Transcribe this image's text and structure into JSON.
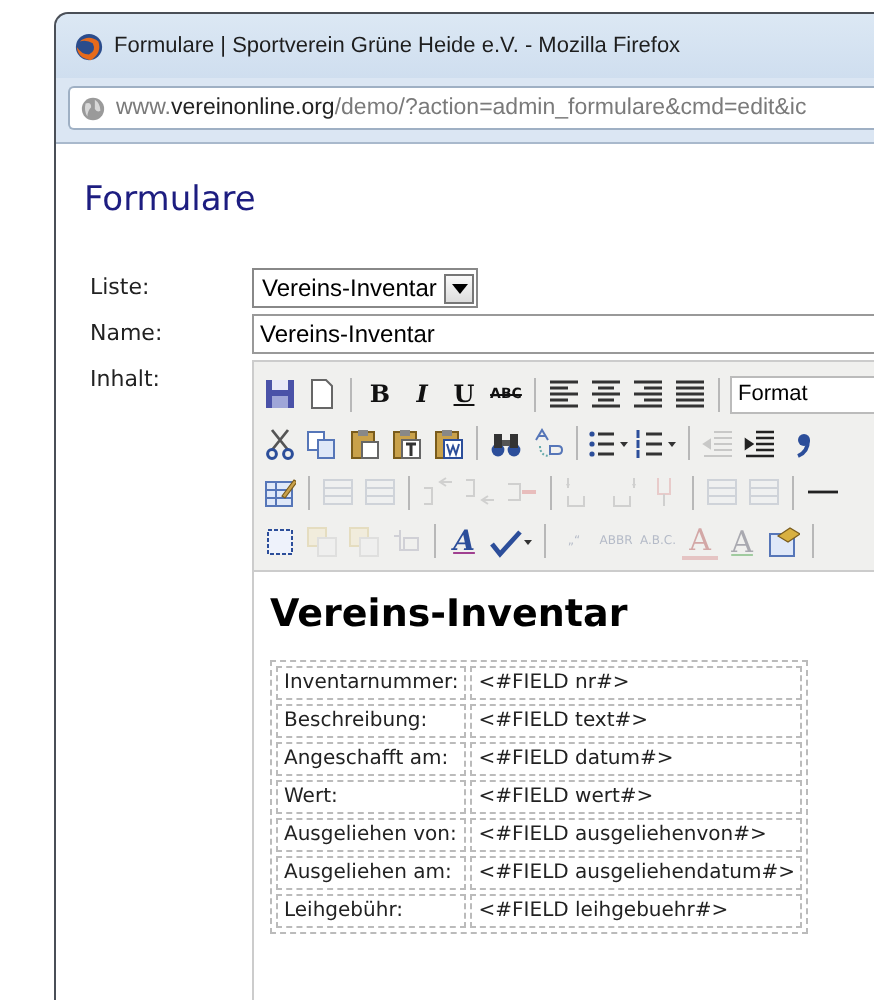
{
  "window": {
    "title": "Formulare | Sportverein Grüne Heide e.V. - Mozilla Firefox"
  },
  "address_bar": {
    "prefix": "www.",
    "domain": "vereinonline.org",
    "path": "/demo/?action=admin_formulare&cmd=edit&ic"
  },
  "heading": "Formulare",
  "form": {
    "fields": [
      {
        "kind": "select",
        "label": "Liste:",
        "value": "Vereins-Inventar"
      },
      {
        "kind": "text",
        "label": "Name:",
        "value": "Vereins-Inventar"
      },
      {
        "kind": "editor",
        "label": "Inhalt:"
      }
    ]
  },
  "editor": {
    "toolbar": [
      [
        {
          "kind": "save",
          "disabled": false
        },
        {
          "kind": "new",
          "disabled": false
        },
        {
          "kind": "separator"
        },
        {
          "kind": "bold",
          "label": "B",
          "disabled": false
        },
        {
          "kind": "italic",
          "label": "I",
          "disabled": false
        },
        {
          "kind": "underline",
          "label": "U",
          "disabled": false
        },
        {
          "kind": "strike",
          "label": "ABC",
          "disabled": false
        },
        {
          "kind": "separator"
        },
        {
          "kind": "alignleft",
          "disabled": false
        },
        {
          "kind": "aligncenter",
          "disabled": false
        },
        {
          "kind": "alignright",
          "disabled": false
        },
        {
          "kind": "justify",
          "disabled": false
        },
        {
          "kind": "separator"
        },
        {
          "kind": "dropdown",
          "label": "Format"
        }
      ],
      [
        {
          "kind": "cut",
          "disabled": false
        },
        {
          "kind": "copy",
          "disabled": false
        },
        {
          "kind": "paste",
          "disabled": false
        },
        {
          "kind": "pastetext",
          "disabled": false
        },
        {
          "kind": "pasteword",
          "disabled": false
        },
        {
          "kind": "separator"
        },
        {
          "kind": "find",
          "disabled": false
        },
        {
          "kind": "replace",
          "disabled": false
        },
        {
          "kind": "separator"
        },
        {
          "kind": "bullets",
          "disabled": false
        },
        {
          "kind": "numbers",
          "disabled": false
        },
        {
          "kind": "separator"
        },
        {
          "kind": "outdent",
          "disabled": true
        },
        {
          "kind": "indent",
          "disabled": false
        },
        {
          "kind": "quote",
          "disabled": false
        }
      ],
      [
        {
          "kind": "tableedit",
          "disabled": false
        },
        {
          "kind": "separator"
        },
        {
          "kind": "tablerow",
          "disabled": true
        },
        {
          "kind": "tablerow",
          "disabled": true
        },
        {
          "kind": "separator"
        },
        {
          "kind": "rowbefore",
          "disabled": true
        },
        {
          "kind": "rowafter",
          "disabled": true
        },
        {
          "kind": "rowdelete",
          "disabled": true
        },
        {
          "kind": "separator"
        },
        {
          "kind": "colbefore",
          "disabled": true
        },
        {
          "kind": "colafter",
          "disabled": true
        },
        {
          "kind": "coldelete",
          "disabled": true
        },
        {
          "kind": "separator"
        },
        {
          "kind": "tablerow",
          "disabled": true
        },
        {
          "kind": "tablerow",
          "disabled": true
        },
        {
          "kind": "separator"
        },
        {
          "kind": "hr",
          "disabled": false
        }
      ],
      [
        {
          "kind": "selection",
          "disabled": false
        },
        {
          "kind": "layer",
          "disabled": true
        },
        {
          "kind": "layer",
          "disabled": true
        },
        {
          "kind": "insert",
          "disabled": true
        },
        {
          "kind": "separator"
        },
        {
          "kind": "styles",
          "label": "A",
          "disabled": false
        },
        {
          "kind": "spell",
          "disabled": false
        },
        {
          "kind": "separator"
        },
        {
          "kind": "tiny",
          "label": "„“",
          "disabled": true
        },
        {
          "kind": "tiny",
          "label": "ABBR",
          "disabled": true
        },
        {
          "kind": "tiny",
          "label": "A.B.C.",
          "disabled": true
        },
        {
          "kind": "strikea",
          "label": "A",
          "disabled": true
        },
        {
          "kind": "plaina",
          "label": "A",
          "disabled": true
        },
        {
          "kind": "template",
          "disabled": false
        },
        {
          "kind": "separator"
        }
      ]
    ],
    "content": {
      "title": "Vereins-Inventar",
      "rows": [
        [
          "Inventarnummer:",
          "<#FIELD nr#>"
        ],
        [
          "Beschreibung:",
          "<#FIELD text#>"
        ],
        [
          "Angeschafft am:",
          "<#FIELD datum#>"
        ],
        [
          "Wert:",
          "<#FIELD wert#>"
        ],
        [
          "Ausgeliehen von:",
          "<#FIELD ausgeliehenvon#>"
        ],
        [
          "Ausgeliehen am:",
          "<#FIELD ausgeliehendatum#>"
        ],
        [
          "Leihgebühr:",
          "<#FIELD leihgebuehr#>"
        ]
      ]
    }
  }
}
